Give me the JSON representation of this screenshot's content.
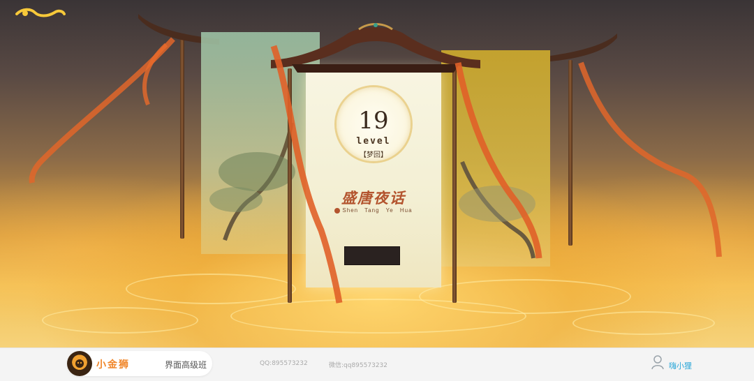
{
  "level_card": {
    "number": "19",
    "word": "level",
    "chapter": "【梦回】",
    "title_cn": "盛唐夜话",
    "title_pinyin": "Shen Tang   Ye   Hua"
  },
  "footer": {
    "brand_name": "小金狮",
    "course": "界面高级班",
    "qq": "QQ:895573232",
    "wechat": "微信:qq895573232",
    "user_name": "嗨小狸"
  },
  "colors": {
    "accent_orange": "#f0862a",
    "title_red": "#b3542e",
    "link_blue": "#28a6d8",
    "gold": "#f2c35a"
  },
  "icons": [
    "golden-cloud-icon",
    "lion-logo-icon",
    "user-icon",
    "seal-icon"
  ]
}
